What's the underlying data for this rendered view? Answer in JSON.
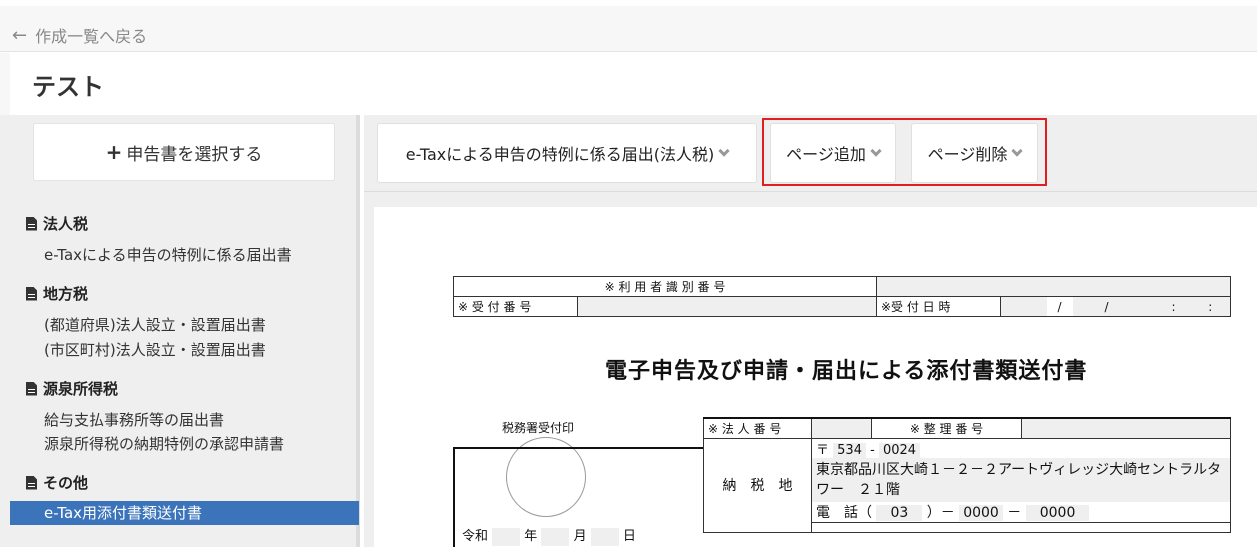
{
  "nav": {
    "back_label": "作成一覧へ戻る"
  },
  "page": {
    "title": "テスト"
  },
  "sidebar": {
    "select_button": "申告書を選択する",
    "categories": [
      {
        "name": "法人税",
        "items": [
          "e-Taxによる申告の特例に係る届出書"
        ]
      },
      {
        "name": "地方税",
        "items": [
          "(都道府県)法人設立・設置届出書",
          "(市区町村)法人設立・設置届出書"
        ]
      },
      {
        "name": "源泉所得税",
        "items": [
          "給与支払事務所等の届出書",
          "源泉所得税の納期特例の承認申請書"
        ]
      },
      {
        "name": "その他",
        "items": [
          "e-Tax用添付書類送付書"
        ]
      }
    ]
  },
  "toolbar": {
    "doc_select": "e-Taxによる申告の特例に係る届出(法人税)",
    "add_page": "ページ追加",
    "delete_page": "ページ削除"
  },
  "document": {
    "header_user_id": "※ 利 用 者 識 別 番 号",
    "header_receipt_no": "※ 受 付 番 号",
    "header_receipt_date": "※受 付 日 時",
    "date_sep1": "/",
    "date_sep2": "/",
    "time_sep1": ":",
    "time_sep2": ":",
    "title": "電子申告及び申請・届出による添付書類送付書",
    "stamp_label": "税務署受付印",
    "corp_no_label": "※ 法 人 番 号",
    "ref_no_label": "※ 整 理 番 号",
    "era": "令和",
    "year": "年",
    "month": "月",
    "day": "日",
    "tax_place_label": "納　税　地",
    "postal_mark": "〒",
    "postal_1": "534",
    "postal_2": "0024",
    "address": "東京都品川区大崎１－２－２アートヴィレッジ大崎セントラルタワー　２１階",
    "tel_label": "電　話（",
    "tel_1": "03",
    "tel_close": "）－",
    "tel_2": "0000",
    "tel_dash": "－",
    "tel_3": "0000"
  }
}
